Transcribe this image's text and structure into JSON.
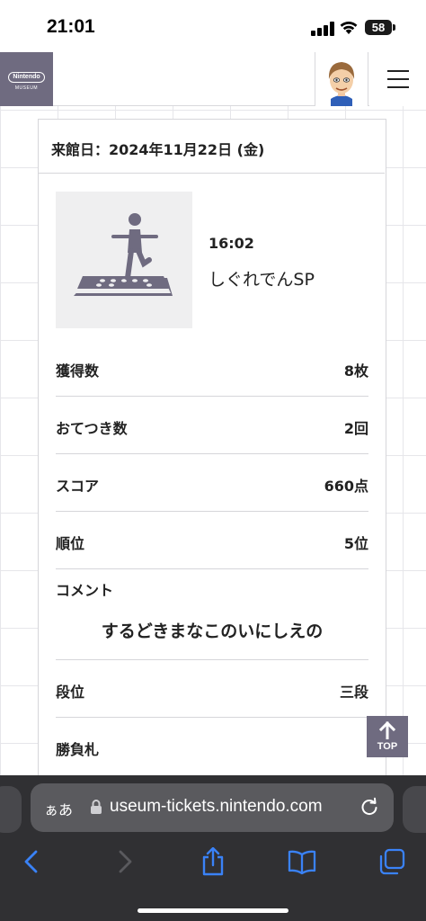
{
  "status_bar": {
    "time": "21:01",
    "battery": "58"
  },
  "site": {
    "logo": {
      "brand": "Nintendo",
      "sub": "MUSEUM"
    },
    "date_line": "来館日：2024年11月22日 (金)",
    "play": {
      "time": "16:02",
      "title": "しぐれでんSP"
    },
    "stats": [
      {
        "label": "獲得数",
        "value": "8枚"
      },
      {
        "label": "おてつき数",
        "value": "2回"
      },
      {
        "label": "スコア",
        "value": "660点"
      },
      {
        "label": "順位",
        "value": "5位"
      }
    ],
    "comment": {
      "label": "コメント",
      "text": "するどきまなこのいにしえの"
    },
    "rank": {
      "label": "段位",
      "value": "三段"
    },
    "card_label": "勝負札",
    "top_button": "TOP"
  },
  "browser": {
    "aa_label": "ぁあ",
    "url": "useum-tickets.nintendo.com"
  },
  "colors": {
    "brand": "#6f6b80",
    "chrome_dark": "#303033",
    "address_bar": "#5a5a5e",
    "ios_blue": "#3a82f7"
  },
  "icons": {
    "menu": "hamburger-menu-icon",
    "play": "person-on-mat-icon",
    "top": "arrow-up-icon",
    "lock": "lock-icon",
    "reload": "reload-icon",
    "back": "chevron-left-icon",
    "forward": "chevron-right-icon",
    "share": "share-icon",
    "bookmarks": "book-icon",
    "tabs": "tabs-icon"
  }
}
